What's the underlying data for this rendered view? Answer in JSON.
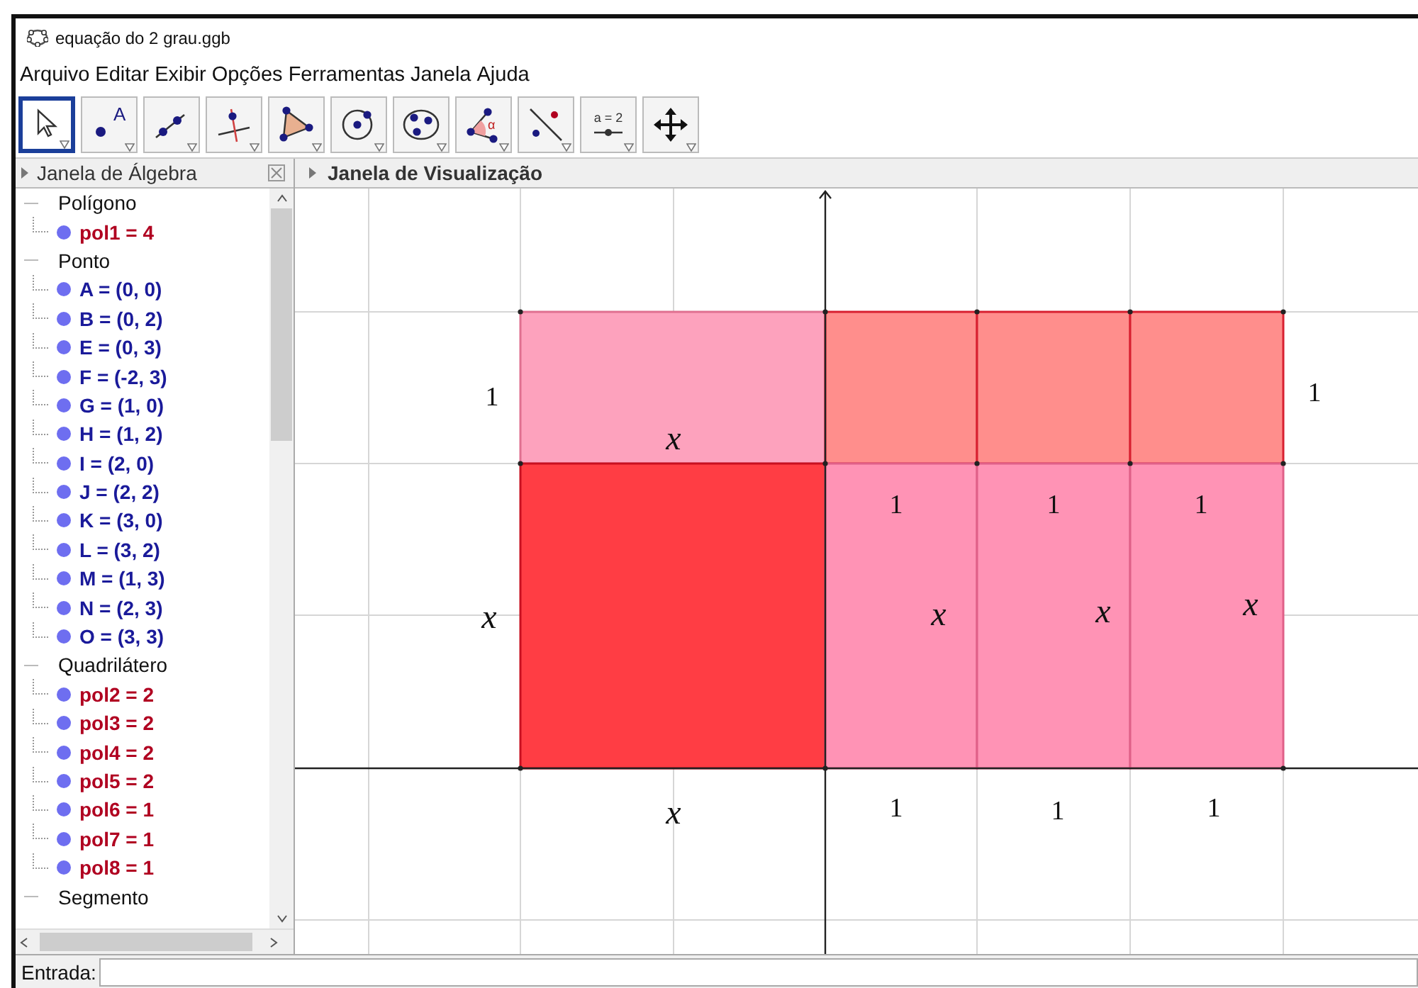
{
  "window": {
    "title": "equação do 2 grau.ggb"
  },
  "menu": [
    "Arquivo",
    "Editar",
    "Exibir",
    "Opções",
    "Ferramentas",
    "Janela",
    "Ajuda"
  ],
  "toolbar": [
    {
      "kind": "move",
      "selected": true
    },
    {
      "kind": "point",
      "label": "A",
      "selected": false
    },
    {
      "kind": "line",
      "selected": false
    },
    {
      "kind": "perpendicular",
      "selected": false
    },
    {
      "kind": "polygon",
      "selected": false
    },
    {
      "kind": "circle",
      "selected": false
    },
    {
      "kind": "conic",
      "selected": false
    },
    {
      "kind": "angle",
      "label": "α",
      "selected": false
    },
    {
      "kind": "reflect",
      "selected": false
    },
    {
      "kind": "slider",
      "label": "a = 2",
      "selected": false
    },
    {
      "kind": "pan",
      "selected": false
    }
  ],
  "algebra": {
    "title": "Janela de Álgebra",
    "groups": [
      {
        "name": "Polígono",
        "expanded": true,
        "children": [
          {
            "text": "pol1 = 4",
            "color": "#b00020"
          }
        ]
      },
      {
        "name": "Ponto",
        "expanded": true,
        "children": [
          {
            "text": "A = (0, 0)",
            "color": "#1a1a9a"
          },
          {
            "text": "B = (0, 2)",
            "color": "#1a1a9a"
          },
          {
            "text": "E = (0, 3)",
            "color": "#1a1a9a"
          },
          {
            "text": "F = (-2, 3)",
            "color": "#1a1a9a"
          },
          {
            "text": "G = (1, 0)",
            "color": "#1a1a9a"
          },
          {
            "text": "H = (1, 2)",
            "color": "#1a1a9a"
          },
          {
            "text": "I = (2, 0)",
            "color": "#1a1a9a"
          },
          {
            "text": "J = (2, 2)",
            "color": "#1a1a9a"
          },
          {
            "text": "K = (3, 0)",
            "color": "#1a1a9a"
          },
          {
            "text": "L = (3, 2)",
            "color": "#1a1a9a"
          },
          {
            "text": "M = (1, 3)",
            "color": "#1a1a9a"
          },
          {
            "text": "N = (2, 3)",
            "color": "#1a1a9a"
          },
          {
            "text": "O = (3, 3)",
            "color": "#1a1a9a"
          }
        ]
      },
      {
        "name": "Quadrilátero",
        "expanded": true,
        "children": [
          {
            "text": "pol2 = 2",
            "color": "#b00020"
          },
          {
            "text": "pol3 = 2",
            "color": "#b00020"
          },
          {
            "text": "pol4 = 2",
            "color": "#b00020"
          },
          {
            "text": "pol5 = 2",
            "color": "#b00020"
          },
          {
            "text": "pol6 = 1",
            "color": "#b00020"
          },
          {
            "text": "pol7 = 1",
            "color": "#b00020"
          },
          {
            "text": "pol8 = 1",
            "color": "#b00020"
          }
        ]
      },
      {
        "name": "Segmento",
        "expanded": true
      }
    ]
  },
  "graphics": {
    "title": "Janela de Visualização",
    "labels": [
      "1",
      "x",
      "1",
      "1",
      "1",
      "1",
      "x",
      "x",
      "x",
      "x",
      "x",
      "1",
      "1",
      "1"
    ]
  },
  "input": {
    "label": "Entrada:"
  }
}
